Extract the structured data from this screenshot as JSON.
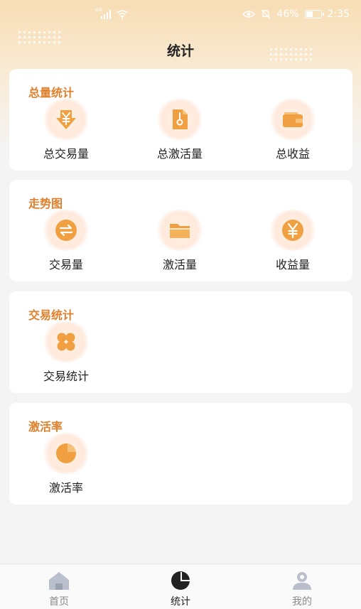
{
  "status_bar": {
    "network": "4G",
    "battery_text": "46%",
    "battery_level": 0.46,
    "time": "2:35",
    "icons": [
      "signal-icon",
      "wifi-icon",
      "eye-icon",
      "mute-icon",
      "battery-icon"
    ]
  },
  "header": {
    "title": "统计"
  },
  "cards": {
    "total": {
      "title": "总量统计",
      "items": [
        {
          "label": "总交易量",
          "icon": "yuan-arrow-icon"
        },
        {
          "label": "总激活量",
          "icon": "document-icon"
        },
        {
          "label": "总收益",
          "icon": "wallet-icon"
        }
      ]
    },
    "trend": {
      "title": "走势图",
      "items": [
        {
          "label": "交易量",
          "icon": "exchange-icon"
        },
        {
          "label": "激活量",
          "icon": "folder-icon"
        },
        {
          "label": "收益量",
          "icon": "yuan-coin-icon"
        }
      ]
    },
    "trade": {
      "title": "交易统计",
      "items": [
        {
          "label": "交易统计",
          "icon": "grid-icon"
        }
      ]
    },
    "activation": {
      "title": "激活率",
      "items": [
        {
          "label": "激活率",
          "icon": "pie-icon"
        }
      ]
    }
  },
  "tabbar": {
    "items": [
      {
        "label": "首页",
        "icon": "home-icon",
        "active": false
      },
      {
        "label": "统计",
        "icon": "pie-chart-icon",
        "active": true
      },
      {
        "label": "我的",
        "icon": "user-icon",
        "active": false
      }
    ]
  },
  "colors": {
    "accent": "#e07f2c",
    "icon_orange": "#f0a040",
    "background": "#f4f4f4"
  }
}
